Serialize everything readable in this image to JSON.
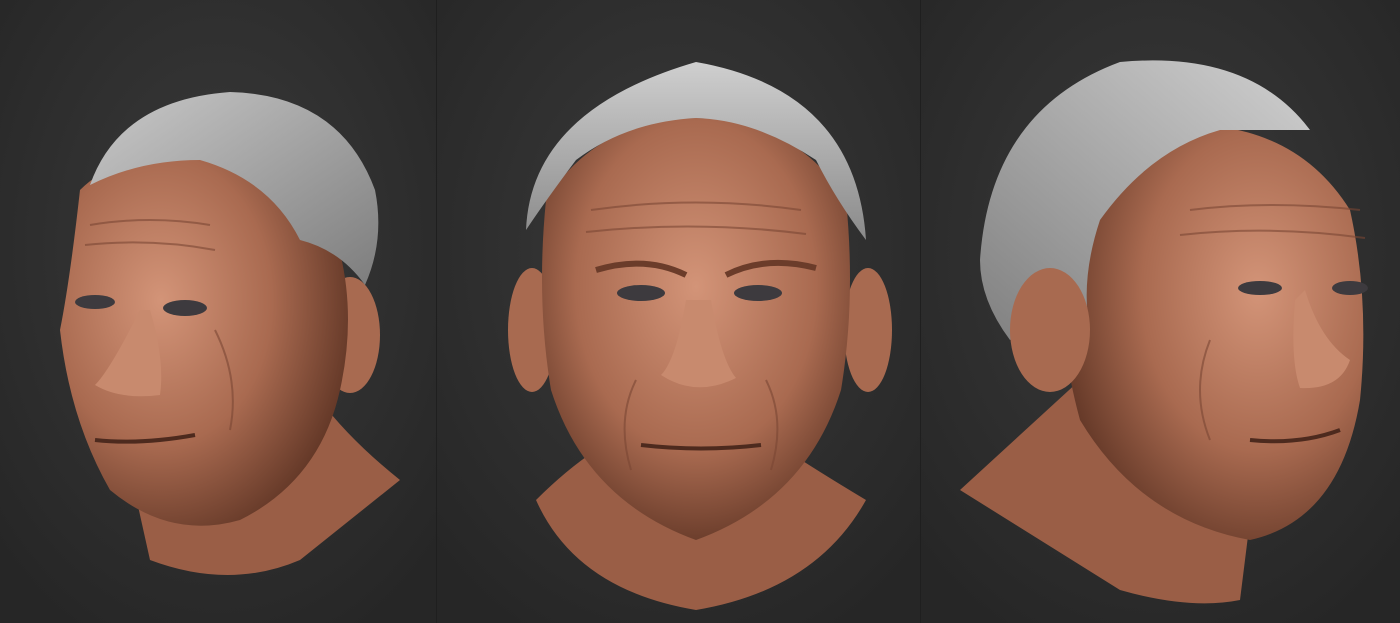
{
  "renders": [
    {
      "view": "three-quarter-left"
    },
    {
      "view": "front"
    },
    {
      "view": "three-quarter-right"
    }
  ],
  "colors": {
    "background": "#2b2b2b",
    "skin": "#b9785e",
    "skin_shadow": "#6e3f2c",
    "hair": "#a9a9a9"
  }
}
